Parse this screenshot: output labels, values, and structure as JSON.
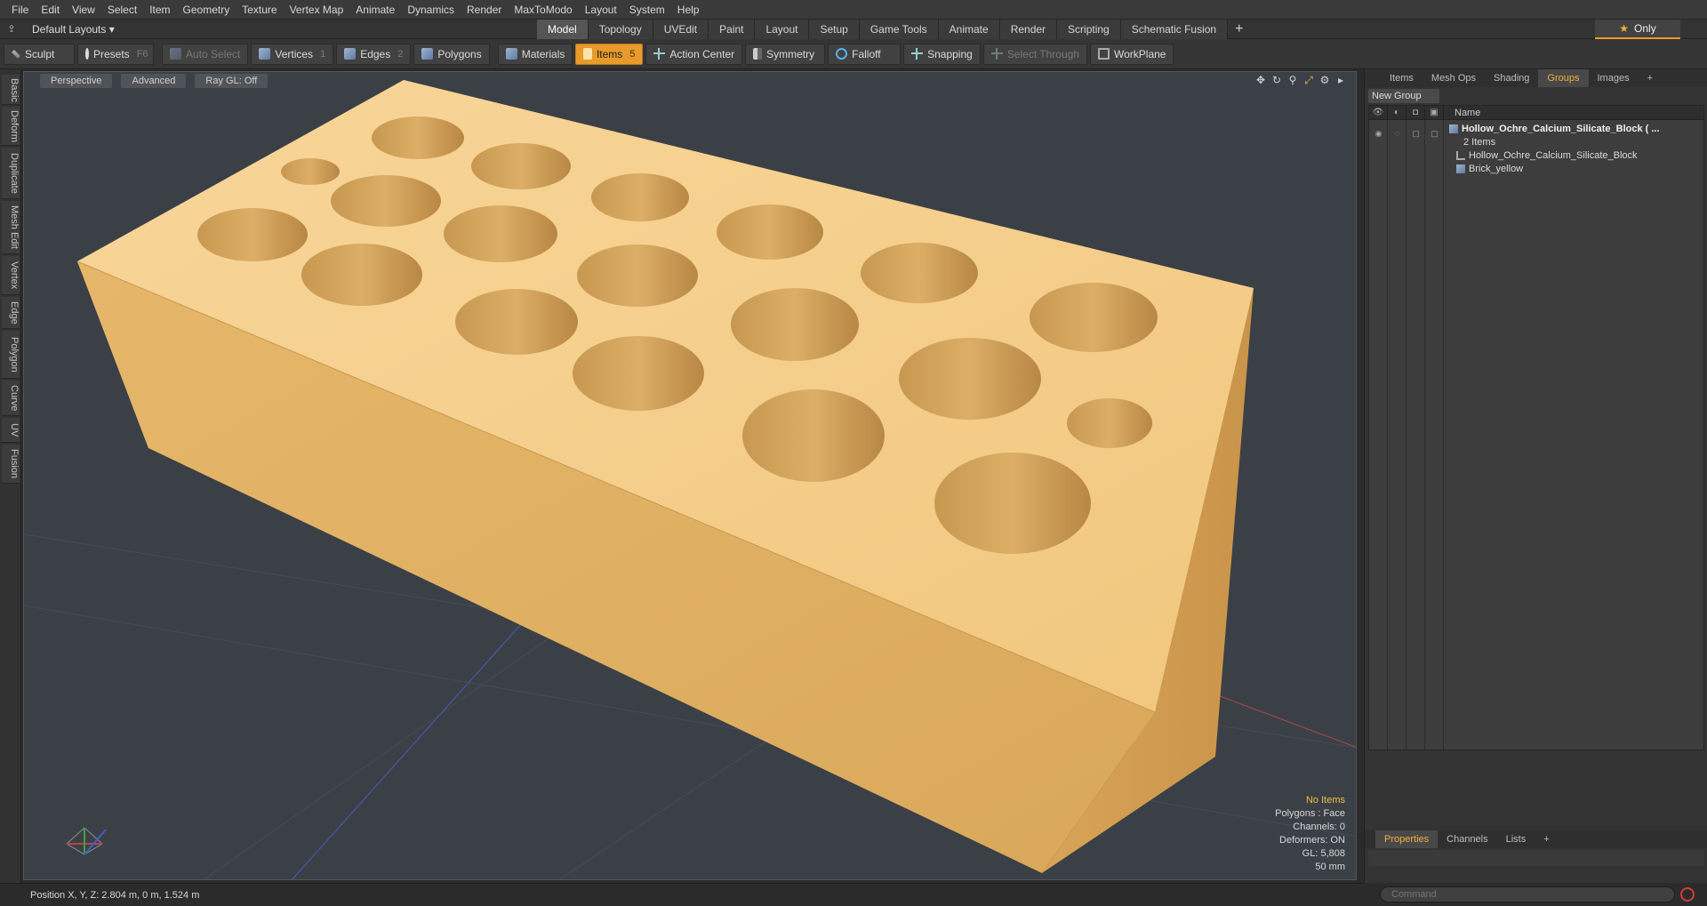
{
  "menu": [
    "File",
    "Edit",
    "View",
    "Select",
    "Item",
    "Geometry",
    "Texture",
    "Vertex Map",
    "Animate",
    "Dynamics",
    "Render",
    "MaxToModo",
    "Layout",
    "System",
    "Help"
  ],
  "layouts": {
    "label": "Default Layouts ▾"
  },
  "tabs": [
    "Model",
    "Topology",
    "UVEdit",
    "Paint",
    "Layout",
    "Setup",
    "Game Tools",
    "Animate",
    "Render",
    "Scripting",
    "Schematic Fusion",
    "+"
  ],
  "active_tab": "Model",
  "only_label": "Only",
  "toolbar": {
    "sculpt": "Sculpt",
    "presets": "Presets",
    "presets_key": "F6",
    "auto_select": "Auto Select",
    "vertices": "Vertices",
    "vertices_key": "1",
    "edges": "Edges",
    "edges_key": "2",
    "polygons": "Polygons",
    "materials": "Materials",
    "items": "Items",
    "items_key": "5",
    "action_center": "Action Center",
    "symmetry": "Symmetry",
    "falloff": "Falloff",
    "snapping": "Snapping",
    "select_through": "Select Through",
    "workplane": "WorkPlane"
  },
  "left_tabs": [
    "Basic",
    "Deform",
    "Duplicate",
    "Mesh Edit",
    "Vertex",
    "Edge",
    "Polygon",
    "Curve",
    "UV",
    "Fusion"
  ],
  "viewport": {
    "view": "Perspective",
    "advanced": "Advanced",
    "raygl": "Ray GL: Off",
    "info": {
      "selection": "No Items",
      "polygons": "Polygons : Face",
      "channels": "Channels: 0",
      "deformers": "Deformers: ON",
      "gl": "GL: 5,808",
      "grid": "50 mm"
    }
  },
  "right_tabs": [
    "Items",
    "Mesh Ops",
    "Shading",
    "Groups",
    "Images",
    "+"
  ],
  "right_active": "Groups",
  "new_group": "New Group",
  "grid_header": {
    "name": "Name"
  },
  "groups": {
    "root": "Hollow_Ochre_Calcium_Silicate_Block ( ...",
    "root_count": "2 Items",
    "child1": "Hollow_Ochre_Calcium_Silicate_Block",
    "child2": "Brick_yellow"
  },
  "prop_tabs": [
    "Properties",
    "Channels",
    "Lists",
    "+"
  ],
  "prop_active": "Properties",
  "command_placeholder": "Command",
  "status": {
    "position": "Position X, Y, Z:   2.804 m, 0 m, 1.524 m"
  },
  "colors": {
    "accent": "#e89a2b",
    "brick_top": "#f6d08e",
    "brick_side": "#e2b46a",
    "viewport_bg": "#3b4047"
  }
}
